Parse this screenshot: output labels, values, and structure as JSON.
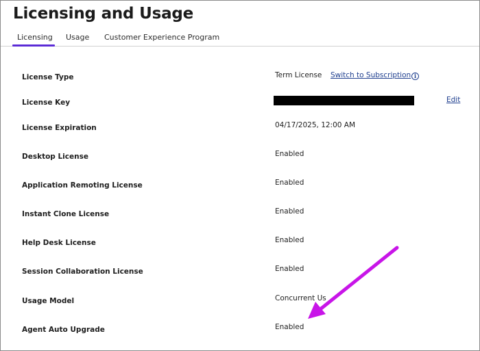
{
  "page": {
    "title": "Licensing and Usage"
  },
  "tabs": [
    {
      "label": "Licensing",
      "active": true
    },
    {
      "label": "Usage",
      "active": false
    },
    {
      "label": "Customer Experience Program",
      "active": false
    }
  ],
  "rows": {
    "license_type": {
      "label": "License Type",
      "value": "Term License",
      "link": "Switch to Subscription"
    },
    "license_key": {
      "label": "License Key",
      "value_redacted": true,
      "link": "Edit"
    },
    "license_expiration": {
      "label": "License Expiration",
      "value": "04/17/2025, 12:00 AM"
    },
    "desktop_license": {
      "label": "Desktop License",
      "value": "Enabled"
    },
    "app_remoting_license": {
      "label": "Application Remoting License",
      "value": "Enabled"
    },
    "instant_clone_license": {
      "label": "Instant Clone License",
      "value": "Enabled"
    },
    "help_desk_license": {
      "label": "Help Desk License",
      "value": "Enabled"
    },
    "session_collab_license": {
      "label": "Session Collaboration License",
      "value": "Enabled"
    },
    "usage_model": {
      "label": "Usage Model",
      "value": "Concurrent Us"
    },
    "agent_auto_upgrade": {
      "label": "Agent Auto Upgrade",
      "value": "Enabled"
    }
  },
  "annotation": {
    "arrow_color": "#c815e8",
    "points_to": "agent_auto_upgrade"
  },
  "colors": {
    "accent": "#5b2bd6",
    "link": "#1f3f8f",
    "text": "#1d1d1d"
  },
  "icons": {
    "info": "info-icon"
  }
}
